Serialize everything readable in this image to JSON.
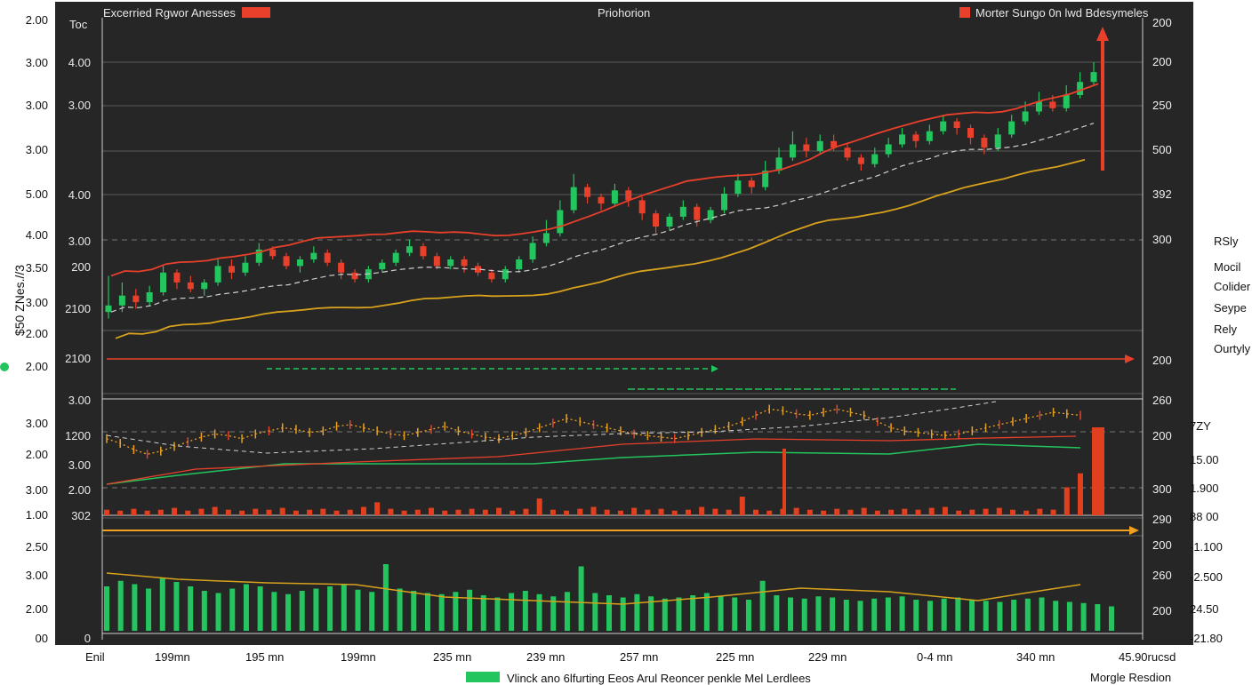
{
  "header": {
    "left_legend": "Excerried Rgwor Anesses",
    "center_title": "Priohorion",
    "right_legend": "Morter Sungo 0n lwd Bdesymeles",
    "corner_label": "Toc"
  },
  "outer_left_axis": [
    "2.00",
    "3.00",
    "3.00",
    "3.00",
    "5.00",
    "4.00",
    "3.50",
    "3.00",
    "2.00",
    "2.00",
    "3.00",
    "2.00",
    "2.00",
    "3.00",
    "2.00",
    "1.00",
    "2.50",
    "2.50",
    "3.00",
    "2.00",
    "00"
  ],
  "inner_left_axis": [
    "4.00",
    "3.00",
    "4.00",
    "4.00",
    "3.00",
    "200",
    "2100",
    "2100",
    "3.00",
    "1200",
    "3.00",
    "2.00",
    "302",
    "0"
  ],
  "right_axis_upper": [
    "200",
    "200",
    "250",
    "500",
    "392",
    "300",
    "200",
    "260"
  ],
  "right_axis_lower": [
    "200",
    "300",
    "290",
    "200",
    "260",
    "200"
  ],
  "far_right_lower": [
    "7ZY",
    "15.00",
    "1.900",
    "88 00",
    "-1.100",
    "-2.500",
    "24.50",
    "-21.80"
  ],
  "right_legend_items": [
    "RSly",
    "Mocil",
    "Colider",
    "Seype",
    "Rely",
    "Ourtyly"
  ],
  "vertical_label": "$50 ZNes.//3",
  "small_label": "2.00",
  "x_axis": {
    "start": "Enil",
    "ticks": [
      "199mn",
      "195 mn",
      "199mn",
      "235 mn",
      "239 mn",
      "257 mn",
      "225 mn",
      "229 mn",
      "0-4 mn",
      "340 mn"
    ],
    "end": "45.90rucsd"
  },
  "footer": {
    "legend": "Vlinck ano 6lfurting Eeos Arul Reoncer penkle Mel Lerdlees",
    "right_caption": "Morgle Resdion"
  },
  "colors": {
    "background": "#262626",
    "up": "#22c55e",
    "down": "#e8402a",
    "ma_red": "#e8402a",
    "ma_yellow": "#d8a21c",
    "ma_white": "#cfcfcf",
    "oscillator_orange": "#f0a020",
    "volume_red": "#e0401e",
    "volume_green": "#22c55e"
  },
  "chart_data": [
    {
      "type": "candlestick",
      "panel": "price",
      "trend": "upward",
      "ylim": [
        0,
        100
      ],
      "candles": [
        [
          24,
          26,
          35,
          22
        ],
        [
          26,
          29,
          33,
          24
        ],
        [
          29,
          27,
          31,
          25
        ],
        [
          27,
          30,
          32,
          26
        ],
        [
          30,
          36,
          38,
          29
        ],
        [
          36,
          33,
          37,
          31
        ],
        [
          33,
          31,
          35,
          30
        ],
        [
          31,
          33,
          34,
          29
        ],
        [
          33,
          38,
          40,
          32
        ],
        [
          38,
          36,
          40,
          34
        ],
        [
          36,
          39,
          41,
          35
        ],
        [
          39,
          43,
          45,
          38
        ],
        [
          43,
          41,
          44,
          40
        ],
        [
          41,
          38,
          42,
          37
        ],
        [
          38,
          40,
          41,
          36
        ],
        [
          40,
          42,
          44,
          39
        ],
        [
          42,
          39,
          43,
          38
        ],
        [
          39,
          36,
          40,
          34
        ],
        [
          36,
          34,
          37,
          33
        ],
        [
          34,
          37,
          38,
          33
        ],
        [
          37,
          39,
          40,
          36
        ],
        [
          39,
          42,
          43,
          38
        ],
        [
          42,
          44,
          46,
          41
        ],
        [
          44,
          41,
          45,
          40
        ],
        [
          41,
          38,
          42,
          37
        ],
        [
          38,
          40,
          41,
          37
        ],
        [
          40,
          38,
          41,
          36
        ],
        [
          38,
          36,
          39,
          35
        ],
        [
          36,
          34,
          37,
          33
        ],
        [
          34,
          37,
          38,
          33
        ],
        [
          37,
          40,
          41,
          36
        ],
        [
          40,
          45,
          47,
          39
        ],
        [
          45,
          48,
          52,
          44
        ],
        [
          48,
          55,
          58,
          47
        ],
        [
          55,
          62,
          66,
          54
        ],
        [
          62,
          59,
          63,
          57
        ],
        [
          59,
          57,
          60,
          55
        ],
        [
          57,
          61,
          63,
          56
        ],
        [
          61,
          58,
          62,
          56
        ],
        [
          58,
          54,
          59,
          52
        ],
        [
          54,
          50,
          55,
          48
        ],
        [
          50,
          53,
          54,
          49
        ],
        [
          53,
          56,
          58,
          52
        ],
        [
          56,
          52,
          57,
          50
        ],
        [
          52,
          55,
          56,
          51
        ],
        [
          55,
          60,
          62,
          54
        ],
        [
          60,
          64,
          66,
          59
        ],
        [
          64,
          62,
          65,
          60
        ],
        [
          62,
          67,
          70,
          61
        ],
        [
          67,
          71,
          74,
          66
        ],
        [
          71,
          75,
          79,
          70
        ],
        [
          75,
          73,
          77,
          71
        ],
        [
          73,
          76,
          78,
          72
        ],
        [
          76,
          74,
          78,
          73
        ],
        [
          74,
          71,
          75,
          70
        ],
        [
          71,
          69,
          72,
          67
        ],
        [
          69,
          72,
          74,
          68
        ],
        [
          72,
          75,
          77,
          71
        ],
        [
          75,
          78,
          80,
          74
        ],
        [
          78,
          76,
          79,
          74
        ],
        [
          76,
          79,
          81,
          75
        ],
        [
          79,
          82,
          84,
          78
        ],
        [
          82,
          80,
          83,
          78
        ],
        [
          80,
          77,
          81,
          75
        ],
        [
          77,
          74,
          78,
          72
        ],
        [
          74,
          78,
          80,
          73
        ],
        [
          78,
          82,
          84,
          77
        ],
        [
          82,
          85,
          88,
          81
        ],
        [
          85,
          88,
          91,
          84
        ],
        [
          88,
          86,
          90,
          85
        ],
        [
          86,
          90,
          93,
          85
        ],
        [
          90,
          94,
          97,
          89
        ],
        [
          94,
          97,
          100,
          93
        ]
      ]
    },
    {
      "type": "line",
      "panel": "oscillator",
      "series": [
        {
          "values": [
            55,
            52,
            48,
            45,
            47,
            50,
            53,
            56,
            58,
            57,
            55,
            58,
            60,
            62,
            61,
            59,
            60,
            63,
            64,
            62,
            60,
            58,
            57,
            59,
            61,
            63,
            60,
            58,
            56,
            55,
            57,
            59,
            62,
            65,
            68,
            66,
            64,
            62,
            60,
            58,
            57,
            56,
            55,
            57,
            59,
            61,
            63,
            66,
            70,
            74,
            73,
            71,
            70,
            72,
            74,
            72,
            70,
            66,
            62,
            60,
            59,
            58,
            57,
            58,
            60,
            62,
            64,
            66,
            68,
            70,
            72,
            71,
            70
          ]
        }
      ]
    },
    {
      "type": "bar",
      "panel": "volume_red",
      "values": [
        6,
        5,
        7,
        5,
        6,
        8,
        5,
        7,
        9,
        6,
        5,
        7,
        6,
        8,
        5,
        6,
        7,
        5,
        6,
        9,
        14,
        7,
        5,
        6,
        8,
        5,
        6,
        7,
        6,
        8,
        5,
        7,
        18,
        6,
        5,
        7,
        9,
        6,
        5,
        8,
        6,
        7,
        5,
        6,
        9,
        7,
        6,
        20,
        6,
        5,
        7,
        8,
        6,
        5,
        7,
        6,
        8,
        5,
        6,
        7,
        6,
        8,
        9,
        5,
        6,
        7,
        8,
        6,
        5,
        7,
        6,
        30,
        45
      ]
    },
    {
      "type": "bar",
      "panel": "volume_green",
      "values": [
        40,
        45,
        42,
        38,
        48,
        44,
        40,
        36,
        34,
        38,
        42,
        40,
        35,
        33,
        36,
        38,
        40,
        42,
        37,
        35,
        60,
        38,
        36,
        34,
        33,
        35,
        37,
        32,
        30,
        34,
        36,
        33,
        31,
        35,
        58,
        34,
        32,
        30,
        33,
        31,
        29,
        30,
        32,
        34,
        31,
        30,
        28,
        45,
        32,
        30,
        29,
        31,
        30,
        28,
        27,
        29,
        30,
        31,
        28,
        27,
        29,
        30,
        28,
        27,
        26,
        28,
        29,
        30,
        27,
        26,
        25,
        24,
        22
      ]
    }
  ]
}
